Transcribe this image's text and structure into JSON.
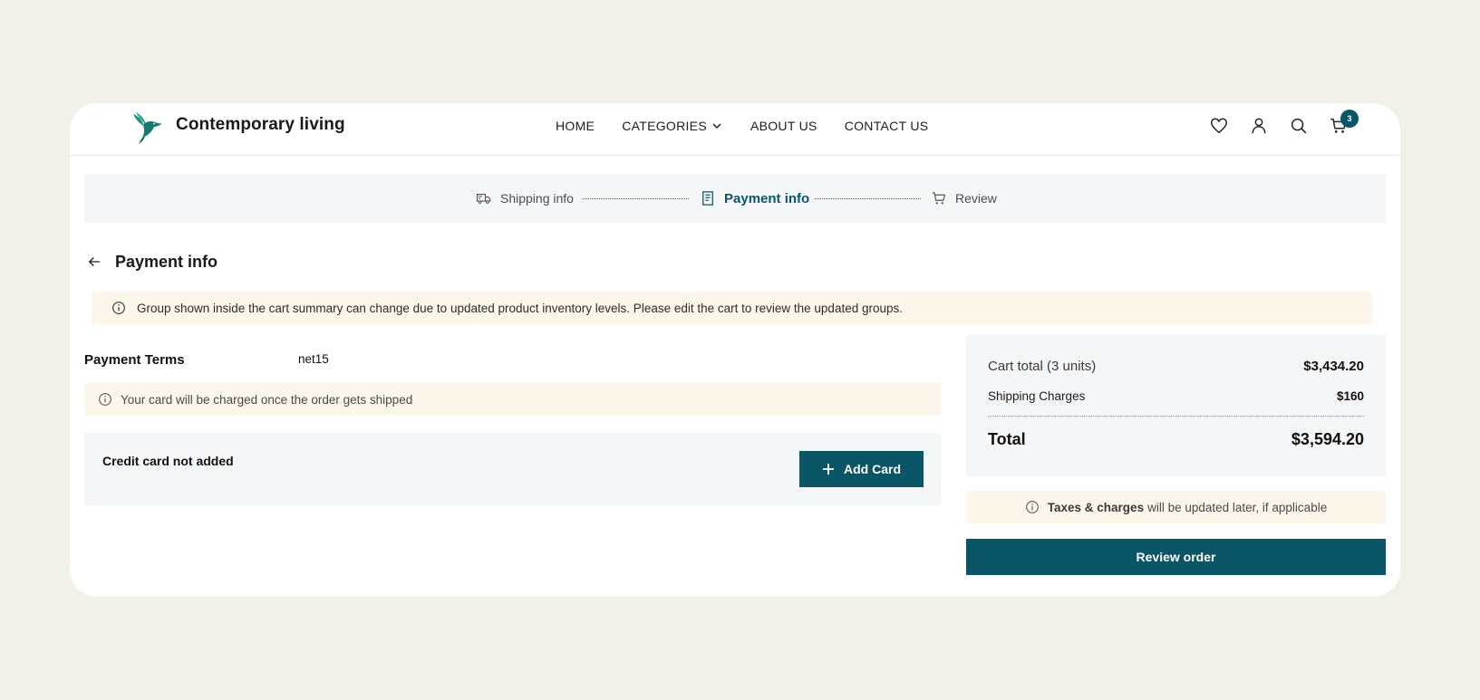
{
  "brand": {
    "name": "Contemporary living",
    "logo_icon": "hummingbird-logo"
  },
  "nav": {
    "home": "HOME",
    "categories": "CATEGORIES",
    "about": "ABOUT US",
    "contact": "CONTACT US"
  },
  "header_icons": {
    "wishlist": "heart-icon",
    "account": "user-icon",
    "search": "search-icon",
    "cart": "cart-icon",
    "cart_count": "3"
  },
  "stepper": {
    "steps": [
      {
        "label": "Shipping info",
        "icon": "truck-icon",
        "state": "done"
      },
      {
        "label": "Payment info",
        "icon": "receipt-icon",
        "state": "active"
      },
      {
        "label": "Review",
        "icon": "cart-icon",
        "state": "pending"
      }
    ]
  },
  "page": {
    "title": "Payment info",
    "alert": "Group shown inside the cart summary can change due to updated product inventory levels. Please edit the cart to review the updated groups."
  },
  "payment": {
    "terms_label": "Payment Terms",
    "terms_value": "net15",
    "charge_note": "Your card will be charged once the order gets shipped",
    "card_status": "Credit card not added",
    "add_card_label": "Add Card"
  },
  "summary": {
    "cart_total_label": "Cart total (3 units)",
    "cart_total_value": "$3,434.20",
    "shipping_label": "Shipping Charges",
    "shipping_value": "$160",
    "total_label": "Total",
    "total_value": "$3,594.20",
    "tax_note_bold": "Taxes & charges",
    "tax_note_rest": "will be updated later, if applicable",
    "review_label": "Review order"
  },
  "colors": {
    "accent": "#0a5566",
    "notice_bg": "#fdf6ea",
    "panel_bg": "#f5f6f7",
    "page_bg": "#f1f1e9"
  }
}
